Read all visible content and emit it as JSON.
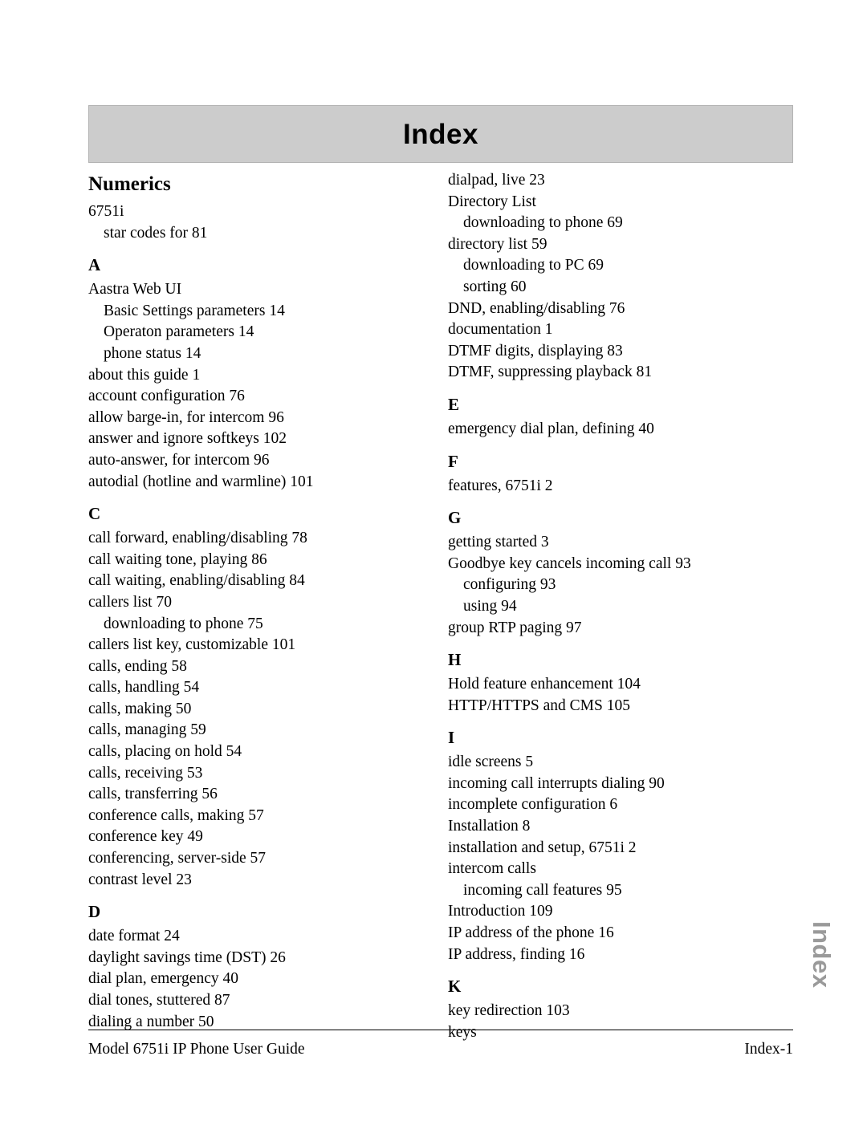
{
  "header": {
    "title": "Index"
  },
  "side_tab": {
    "label": "Index",
    "color": "#9a9a9a"
  },
  "theme": {
    "header_band_bg": "#cccccc",
    "header_band_border": "#b3b3b3",
    "text_color": "#000000"
  },
  "footer": {
    "left": "Model 6751i IP Phone User Guide",
    "right": "Index-1"
  },
  "columns": [
    {
      "name": "left-column",
      "blocks": [
        {
          "type": "group-heading",
          "text": "Numerics"
        },
        {
          "type": "entry",
          "text": "6751i"
        },
        {
          "type": "sub",
          "text": "star codes for 81"
        },
        {
          "type": "letter",
          "text": "A"
        },
        {
          "type": "entry",
          "text": "Aastra Web UI"
        },
        {
          "type": "sub",
          "text": "Basic Settings parameters 14"
        },
        {
          "type": "sub",
          "text": "Operaton parameters 14"
        },
        {
          "type": "sub",
          "text": "phone status 14"
        },
        {
          "type": "entry",
          "text": "about this guide 1"
        },
        {
          "type": "entry",
          "text": "account configuration 76"
        },
        {
          "type": "entry",
          "text": "allow barge-in, for intercom 96"
        },
        {
          "type": "entry",
          "text": "answer and ignore softkeys 102"
        },
        {
          "type": "entry",
          "text": "auto-answer, for intercom 96"
        },
        {
          "type": "entry",
          "text": "autodial (hotline and warmline) 101"
        },
        {
          "type": "letter",
          "text": "C"
        },
        {
          "type": "entry",
          "text": "call forward, enabling/disabling 78"
        },
        {
          "type": "entry",
          "text": "call waiting tone, playing 86"
        },
        {
          "type": "entry",
          "text": "call waiting, enabling/disabling 84"
        },
        {
          "type": "entry",
          "text": "callers list 70"
        },
        {
          "type": "sub",
          "text": "downloading to phone 75"
        },
        {
          "type": "entry",
          "text": "callers list key, customizable 101"
        },
        {
          "type": "entry",
          "text": "calls, ending 58"
        },
        {
          "type": "entry",
          "text": "calls, handling 54"
        },
        {
          "type": "entry",
          "text": "calls, making 50"
        },
        {
          "type": "entry",
          "text": "calls, managing 59"
        },
        {
          "type": "entry",
          "text": "calls, placing on hold 54"
        },
        {
          "type": "entry",
          "text": "calls, receiving 53"
        },
        {
          "type": "entry",
          "text": "calls, transferring 56"
        },
        {
          "type": "entry",
          "text": "conference calls, making 57"
        },
        {
          "type": "entry",
          "text": "conference key 49"
        },
        {
          "type": "entry",
          "text": "conferencing, server-side 57"
        },
        {
          "type": "entry",
          "text": "contrast level 23"
        },
        {
          "type": "letter",
          "text": "D"
        },
        {
          "type": "entry",
          "text": "date format 24"
        },
        {
          "type": "entry",
          "text": "daylight savings time (DST) 26"
        },
        {
          "type": "entry",
          "text": "dial plan, emergency 40"
        },
        {
          "type": "entry",
          "text": "dial tones, stuttered 87"
        },
        {
          "type": "entry",
          "text": "dialing a number 50"
        }
      ]
    },
    {
      "name": "right-column",
      "blocks": [
        {
          "type": "entry",
          "text": "dialpad, live 23"
        },
        {
          "type": "entry",
          "text": "Directory List"
        },
        {
          "type": "sub",
          "text": "downloading to phone 69"
        },
        {
          "type": "entry",
          "text": "directory list 59"
        },
        {
          "type": "sub",
          "text": "downloading to PC 69"
        },
        {
          "type": "sub",
          "text": "sorting 60"
        },
        {
          "type": "entry",
          "text": "DND, enabling/disabling 76"
        },
        {
          "type": "entry",
          "text": "documentation 1"
        },
        {
          "type": "entry",
          "text": "DTMF digits, displaying 83"
        },
        {
          "type": "entry",
          "text": "DTMF, suppressing playback 81"
        },
        {
          "type": "letter",
          "text": "E"
        },
        {
          "type": "entry",
          "text": "emergency dial plan, defining 40"
        },
        {
          "type": "letter",
          "text": "F"
        },
        {
          "type": "entry",
          "text": "features, 6751i 2"
        },
        {
          "type": "letter",
          "text": "G"
        },
        {
          "type": "entry",
          "text": "getting started 3"
        },
        {
          "type": "entry",
          "text": "Goodbye key cancels incoming call 93"
        },
        {
          "type": "sub",
          "text": "configuring 93"
        },
        {
          "type": "sub",
          "text": "using 94"
        },
        {
          "type": "entry",
          "text": "group RTP paging 97"
        },
        {
          "type": "letter",
          "text": "H"
        },
        {
          "type": "entry",
          "text": "Hold feature enhancement 104"
        },
        {
          "type": "entry",
          "text": "HTTP/HTTPS and CMS 105"
        },
        {
          "type": "letter",
          "text": "I"
        },
        {
          "type": "entry",
          "text": "idle screens 5"
        },
        {
          "type": "entry",
          "text": "incoming call interrupts dialing 90"
        },
        {
          "type": "entry",
          "text": "incomplete configuration 6"
        },
        {
          "type": "entry",
          "text": "Installation 8"
        },
        {
          "type": "entry",
          "text": "installation and setup, 6751i 2"
        },
        {
          "type": "entry",
          "text": "intercom calls"
        },
        {
          "type": "sub",
          "text": "incoming call features 95"
        },
        {
          "type": "entry",
          "text": "Introduction 109"
        },
        {
          "type": "entry",
          "text": "IP address of the phone 16"
        },
        {
          "type": "entry",
          "text": "IP address, finding 16"
        },
        {
          "type": "letter",
          "text": "K"
        },
        {
          "type": "entry",
          "text": "key redirection 103"
        },
        {
          "type": "entry",
          "text": "keys"
        }
      ]
    }
  ]
}
